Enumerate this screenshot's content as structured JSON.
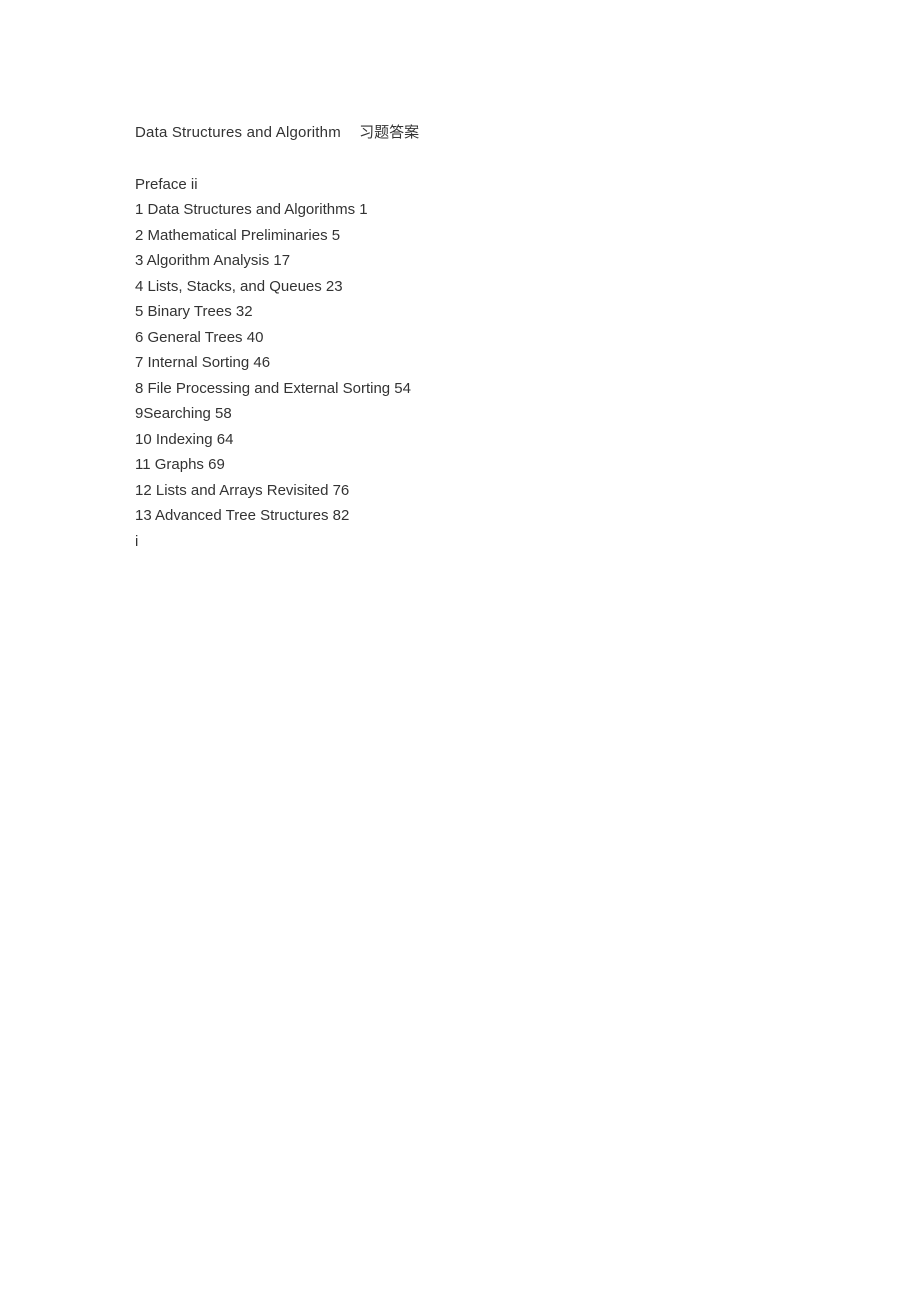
{
  "title": {
    "en": "Data Structures and Algorithm",
    "cn": "习题答案"
  },
  "toc": [
    "Preface ii",
    "1 Data Structures and Algorithms 1",
    "2 Mathematical Preliminaries 5",
    "3 Algorithm Analysis 17",
    "4 Lists, Stacks, and Queues 23",
    "5 Binary Trees 32",
    "6 General Trees 40",
    "7 Internal Sorting 46",
    "8 File Processing and External Sorting 54",
    "9Searching 58",
    "10 Indexing 64",
    "11 Graphs 69",
    "12 Lists and Arrays Revisited 76",
    "13 Advanced Tree Structures 82",
    "i"
  ]
}
